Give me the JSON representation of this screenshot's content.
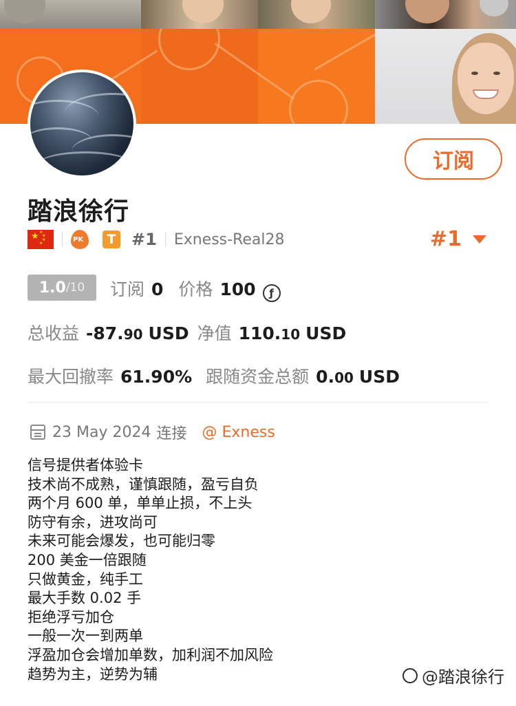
{
  "profile": {
    "name": "踏浪徐行",
    "subscribe_label": "订阅",
    "rank_small": "#1",
    "broker_account": "Exness-Real28",
    "rank_big": "#1",
    "badges": {
      "pk": "PK",
      "t": "T"
    }
  },
  "stats": {
    "rating_value": "1.0",
    "rating_max": "/10",
    "subscriptions_label": "订阅",
    "subscriptions_value": "0",
    "price_label": "价格",
    "price_value": "100",
    "price_currency_symbol": "ƒ",
    "total_profit_label": "总收益",
    "total_profit_int": "-87.",
    "total_profit_dec": "90",
    "total_profit_unit": "USD",
    "equity_label": "净值",
    "equity_int": "110.",
    "equity_dec": "10",
    "equity_unit": "USD",
    "max_drawdown_label": "最大回撤率",
    "max_drawdown_value": "61.90%",
    "follow_funds_label": "跟随资金总额",
    "follow_funds_int": "0.",
    "follow_funds_dec": "00",
    "follow_funds_unit": "USD"
  },
  "connection": {
    "date": "23 May 2024",
    "connected_label": "连接",
    "broker": "@ Exness"
  },
  "description": [
    "信号提供者体验卡",
    "技术尚不成熟，谨慎跟随，盈亏自负",
    "两个月 600 单，单单止损，不上头",
    "防守有余，进攻尚可",
    "未来可能会爆发，也可能归零",
    "200 美金一倍跟随",
    "只做黄金，纯手工",
    "最大手数 0.02 手",
    "拒绝浮亏加仓",
    "一般一次一到两单",
    "浮盈加仓会增加单数，加利润不加风险",
    "趋势为主，逆势为辅"
  ],
  "watermark": "@踏浪徐行",
  "colors": {
    "accent": "#ec6b2a",
    "banner_orange": "#f5711f"
  }
}
